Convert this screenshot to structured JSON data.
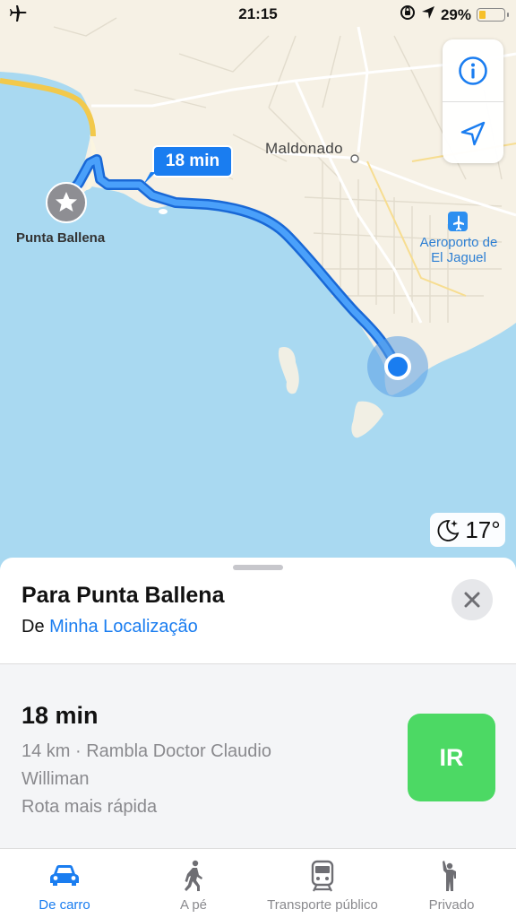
{
  "status_bar": {
    "time": "21:15",
    "battery": "29%",
    "battery_level": 0.29
  },
  "map": {
    "places": {
      "maldonado": "Maldonado",
      "destination": "Punta Ballena",
      "airport": "Aeroporto de\nEl Jaguel"
    },
    "eta_callout": "18 min",
    "weather": {
      "temperature": "17°",
      "icon": "moon-stars-icon"
    },
    "controls": [
      "info-icon",
      "location-arrow-icon"
    ]
  },
  "sheet": {
    "title": "Para Punta Ballena",
    "from_prefix": "De ",
    "from_link": "Minha Localização",
    "route": {
      "time": "18 min",
      "description_line1": "14 km · Rambla Doctor Claudio",
      "description_line2": "Williman",
      "description_line3": "Rota mais rápida",
      "go_label": "IR"
    }
  },
  "tabs": [
    {
      "label": "De carro",
      "icon": "car-icon",
      "active": true
    },
    {
      "label": "A pé",
      "icon": "walking-icon",
      "active": false
    },
    {
      "label": "Transporte público",
      "icon": "train-icon",
      "active": false
    },
    {
      "label": "Privado",
      "icon": "hail-icon",
      "active": false
    }
  ],
  "colors": {
    "accent": "#1a7df0",
    "go": "#4cd964",
    "water": "#a7d8f0",
    "land": "#f6f0e3",
    "route": "#3b93f7"
  }
}
